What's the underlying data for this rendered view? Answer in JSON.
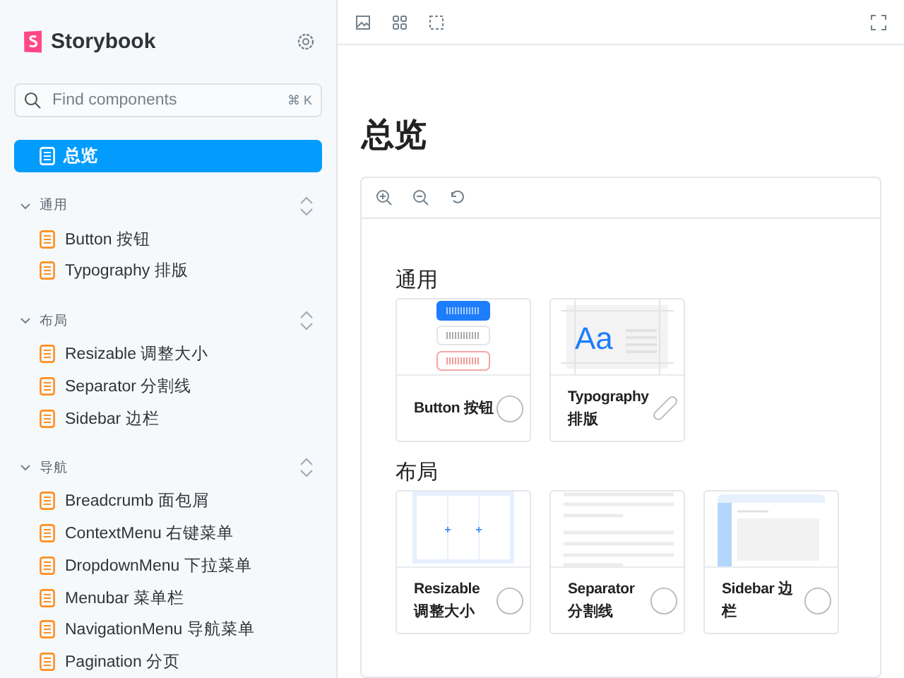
{
  "sidebar": {
    "brand": "Storybook",
    "search": {
      "placeholder": "Find components",
      "shortcut": "⌘ K"
    },
    "top_item": {
      "label": "总览",
      "selected": true
    },
    "groups": [
      {
        "title": "通用",
        "expanded": true,
        "items": [
          "Button 按钮",
          "Typography 排版"
        ]
      },
      {
        "title": "布局",
        "expanded": true,
        "items": [
          "Resizable 调整大小",
          "Separator 分割线",
          "Sidebar 边栏"
        ]
      },
      {
        "title": "导航",
        "expanded": true,
        "items": [
          "Breadcrumb 面包屑",
          "ContextMenu 右键菜单",
          "DropdownMenu 下拉菜单",
          "Menubar 菜单栏",
          "NavigationMenu 导航菜单",
          "Pagination 分页"
        ]
      }
    ]
  },
  "main": {
    "title": "总览",
    "sections": [
      {
        "title": "通用",
        "cards": [
          {
            "label": "Button 按钮",
            "kind": "buttons"
          },
          {
            "label": "Typography 排版",
            "kind": "typography",
            "sample": "Aa"
          }
        ]
      },
      {
        "title": "布局",
        "cards": [
          {
            "label": "Resizable 调整大小",
            "kind": "resizable"
          },
          {
            "label": "Separator 分割线",
            "kind": "separator"
          },
          {
            "label": "Sidebar 边栏",
            "kind": "sidebar"
          }
        ]
      }
    ]
  }
}
